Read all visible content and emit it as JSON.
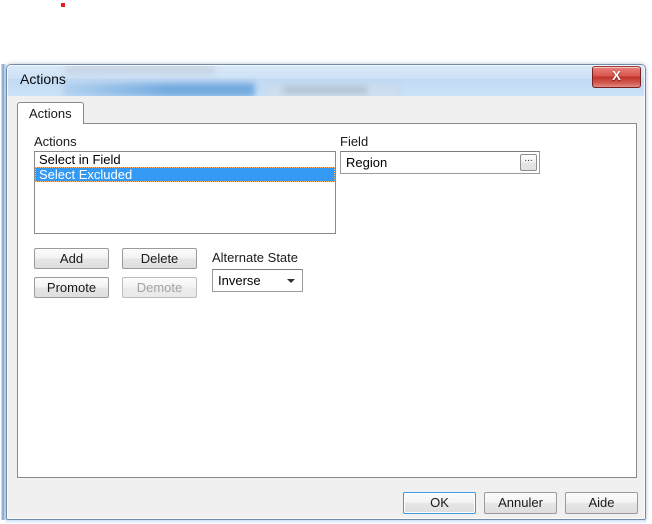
{
  "window": {
    "title": "Actions",
    "close_icon": "close-x-icon",
    "close_label": "X"
  },
  "tabs": [
    {
      "label": "Actions",
      "active": true
    }
  ],
  "panel": {
    "actions_group": {
      "label": "Actions",
      "items": [
        {
          "label": "Select in Field",
          "selected": false
        },
        {
          "label": "Select Excluded",
          "selected": true
        }
      ]
    },
    "field_group": {
      "label": "Field",
      "value": "Region",
      "placeholder": "",
      "browse_button_label": "...",
      "browse_icon": "ellipsis-icon"
    },
    "action_buttons": [
      {
        "label": "Add",
        "enabled": true
      },
      {
        "label": "Delete",
        "enabled": true
      },
      {
        "label": "Promote",
        "enabled": true
      },
      {
        "label": "Demote",
        "enabled": false
      }
    ],
    "alternate_state": {
      "label": "Alternate State",
      "value": "Inverse",
      "dropdown_icon": "chevron-down-icon"
    }
  },
  "footer": {
    "ok_label": "OK",
    "cancel_label": "Annuler",
    "help_label": "Aide"
  },
  "colors": {
    "selection_blue": "#3399f3",
    "titlebar_blue": "#cfe2f6",
    "close_red": "#c1332a",
    "default_button_border": "#3c9ade",
    "dialog_face": "#f0f0f0",
    "panel_white": "#ffffff",
    "marker_red": "#e02020"
  }
}
